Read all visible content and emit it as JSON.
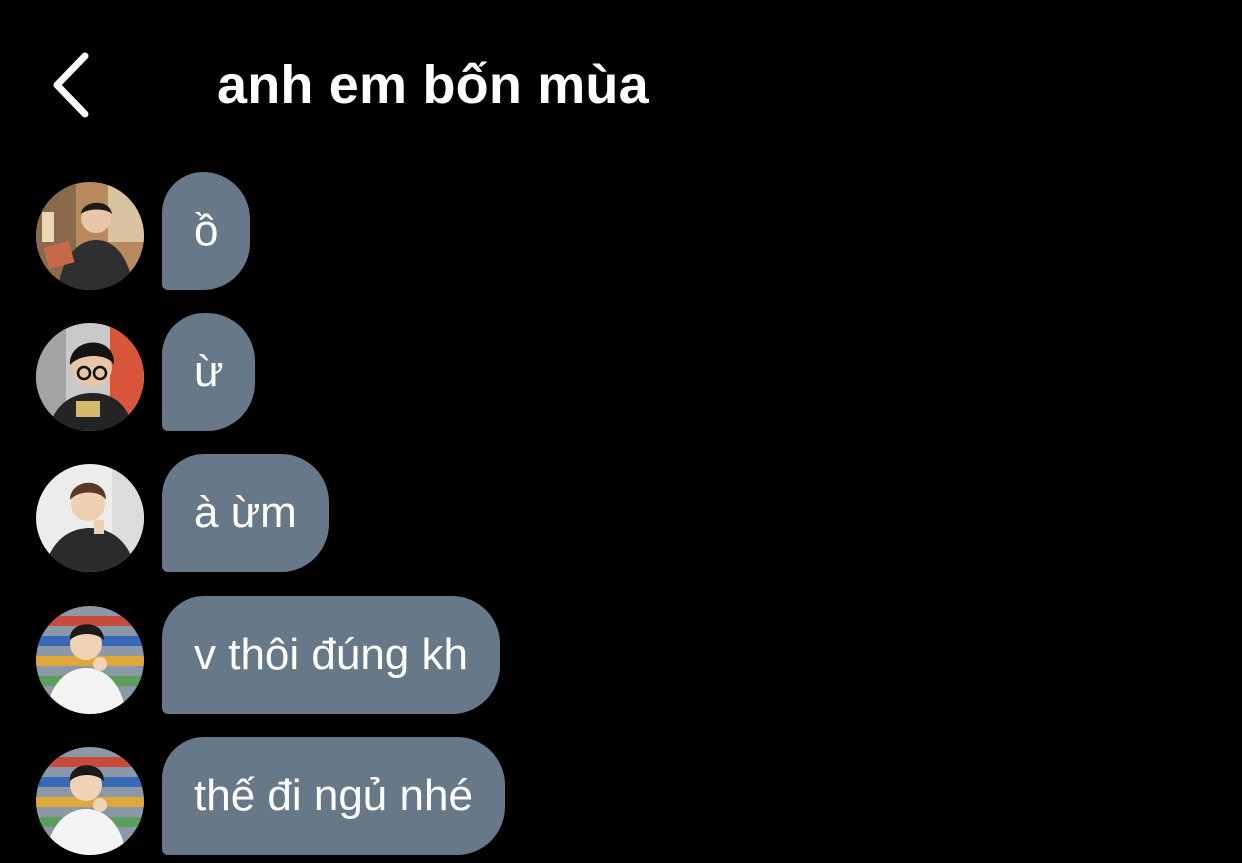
{
  "header": {
    "back_icon": "chevron-left-icon",
    "title": "anh em bốn mùa"
  },
  "messages": [
    {
      "text": "ồ",
      "avatar": "member-1-avatar"
    },
    {
      "text": "ừ",
      "avatar": "member-2-avatar"
    },
    {
      "text": "à ừm",
      "avatar": "member-3-avatar"
    },
    {
      "text": "v thôi đúng kh",
      "avatar": "member-4-avatar"
    },
    {
      "text": "thế đi ngủ nhé",
      "avatar": "member-4-avatar"
    }
  ],
  "colors": {
    "background": "#000000",
    "bubble": "#677889",
    "text": "#ffffff"
  }
}
